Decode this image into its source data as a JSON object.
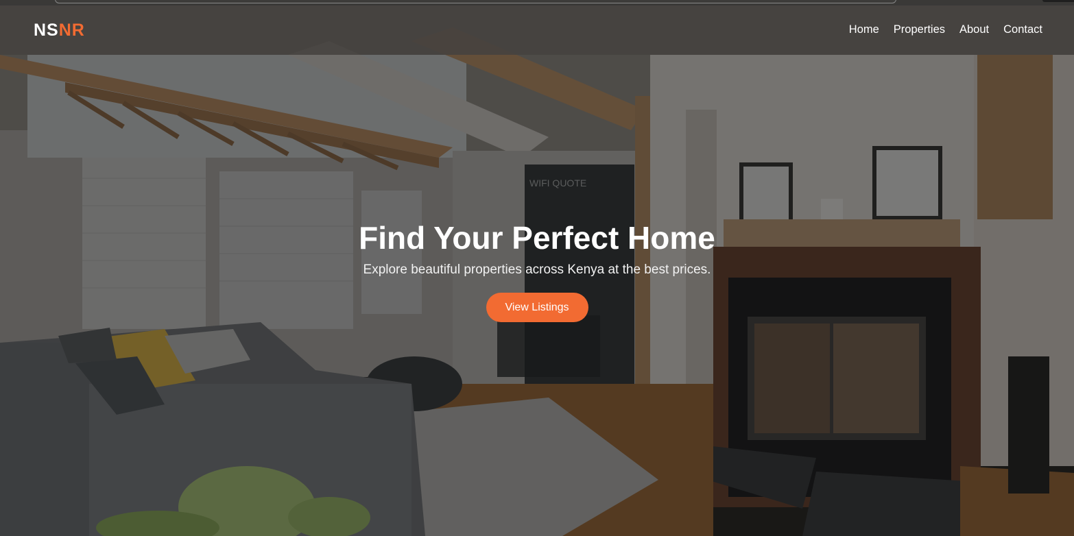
{
  "brand": {
    "logo_part1": "NS",
    "logo_part2": "NR",
    "accent_color": "#f26b32"
  },
  "nav": {
    "items": [
      {
        "label": "Home"
      },
      {
        "label": "Properties"
      },
      {
        "label": "About"
      },
      {
        "label": "Contact"
      }
    ]
  },
  "hero": {
    "title": "Find Your Perfect Home",
    "subtitle": "Explore beautiful properties across Kenya at the best prices.",
    "cta_label": "View Listings",
    "background": "living-room-photo",
    "wall_sign_text": "WIFI QUOTE"
  }
}
